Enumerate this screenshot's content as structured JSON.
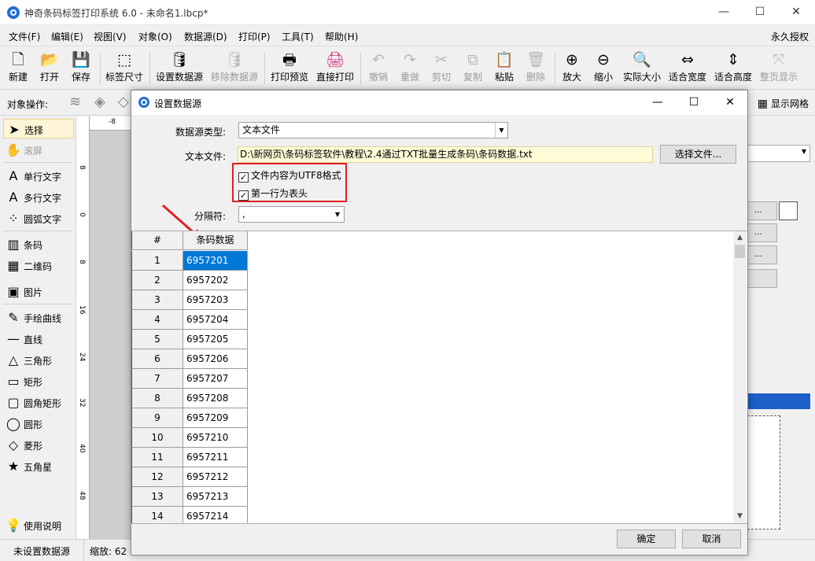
{
  "window": {
    "title": "神奇条码标签打印系统 6.0 - 未命名1.lbcp*",
    "minimize": "—",
    "maximize": "☐",
    "close": "✕"
  },
  "menu": {
    "items": [
      "文件(F)",
      "编辑(E)",
      "视图(V)",
      "对象(O)",
      "数据源(D)",
      "打印(P)",
      "工具(T)",
      "帮助(H)"
    ],
    "license": "永久授权"
  },
  "toolbar": {
    "buttons": [
      {
        "label": "新建",
        "icon": "new-file-icon",
        "glyph": "🗋",
        "enabled": true
      },
      {
        "label": "打开",
        "icon": "open-icon",
        "glyph": "📂",
        "enabled": true
      },
      {
        "label": "保存",
        "icon": "save-icon",
        "glyph": "💾",
        "enabled": true
      },
      {
        "label": "标签尺寸",
        "icon": "label-size-icon",
        "glyph": "⬚",
        "enabled": true
      },
      {
        "label": "设置数据源",
        "icon": "database-icon",
        "glyph": "🛢",
        "enabled": true
      },
      {
        "label": "移除数据源",
        "icon": "database-remove-icon",
        "glyph": "🛢",
        "enabled": false
      },
      {
        "label": "打印预览",
        "icon": "print-preview-icon",
        "glyph": "🖶",
        "enabled": true
      },
      {
        "label": "直接打印",
        "icon": "print-icon",
        "glyph": "🖨",
        "enabled": true
      },
      {
        "label": "撤销",
        "icon": "undo-icon",
        "glyph": "↶",
        "enabled": false
      },
      {
        "label": "重做",
        "icon": "redo-icon",
        "glyph": "↷",
        "enabled": false
      },
      {
        "label": "剪切",
        "icon": "cut-icon",
        "glyph": "✂",
        "enabled": false
      },
      {
        "label": "复制",
        "icon": "copy-icon",
        "glyph": "⧉",
        "enabled": false
      },
      {
        "label": "粘贴",
        "icon": "paste-icon",
        "glyph": "📋",
        "enabled": true
      },
      {
        "label": "删除",
        "icon": "delete-icon",
        "glyph": "🗑",
        "enabled": false
      },
      {
        "label": "放大",
        "icon": "zoom-in-icon",
        "glyph": "⊕",
        "enabled": true
      },
      {
        "label": "缩小",
        "icon": "zoom-out-icon",
        "glyph": "⊖",
        "enabled": true
      },
      {
        "label": "实际大小",
        "icon": "actual-size-icon",
        "glyph": "🔍",
        "enabled": true
      },
      {
        "label": "适合宽度",
        "icon": "fit-width-icon",
        "glyph": "⇔",
        "enabled": true
      },
      {
        "label": "适合高度",
        "icon": "fit-height-icon",
        "glyph": "⇕",
        "enabled": true
      },
      {
        "label": "整页显示",
        "icon": "fit-page-icon",
        "glyph": "⤧",
        "enabled": false
      }
    ]
  },
  "object_bar": {
    "label": "对象操作:",
    "grid_toggle": "显示网格"
  },
  "tools": {
    "items": [
      {
        "label": "选择",
        "glyph": "➤",
        "selected": true,
        "enabled": true
      },
      {
        "label": "滚屏",
        "glyph": "✋",
        "selected": false,
        "enabled": false
      },
      {
        "label": "单行文字",
        "glyph": "A",
        "selected": false,
        "enabled": true
      },
      {
        "label": "多行文字",
        "glyph": "A",
        "selected": false,
        "enabled": true
      },
      {
        "label": "圆弧文字",
        "glyph": "⁘",
        "selected": false,
        "enabled": true
      },
      {
        "label": "条码",
        "glyph": "▥",
        "selected": false,
        "enabled": true
      },
      {
        "label": "二维码",
        "glyph": "▦",
        "selected": false,
        "enabled": true
      },
      {
        "label": "图片",
        "glyph": "▣",
        "selected": false,
        "enabled": true
      },
      {
        "label": "手绘曲线",
        "glyph": "✎",
        "selected": false,
        "enabled": true
      },
      {
        "label": "直线",
        "glyph": "—",
        "selected": false,
        "enabled": true
      },
      {
        "label": "三角形",
        "glyph": "△",
        "selected": false,
        "enabled": true
      },
      {
        "label": "矩形",
        "glyph": "▭",
        "selected": false,
        "enabled": true
      },
      {
        "label": "圆角矩形",
        "glyph": "▢",
        "selected": false,
        "enabled": true
      },
      {
        "label": "圆形",
        "glyph": "◯",
        "selected": false,
        "enabled": true
      },
      {
        "label": "菱形",
        "glyph": "◇",
        "selected": false,
        "enabled": true
      },
      {
        "label": "五角星",
        "glyph": "★",
        "selected": false,
        "enabled": true
      }
    ],
    "help": {
      "label": "使用说明",
      "glyph": "💡"
    }
  },
  "ruler": {
    "top_mark": "-8",
    "left_marks": [
      "8",
      "0",
      "8",
      "16",
      "24",
      "32",
      "40",
      "48"
    ]
  },
  "status": {
    "datasource": "未设置数据源",
    "zoom": "缩放: 62"
  },
  "dialog": {
    "title": "设置数据源",
    "source_type_label": "数据源类型:",
    "source_type_value": "文本文件",
    "text_file_label": "文本文件:",
    "text_file_path": "D:\\新网页\\条码标签软件\\教程\\2.4通过TXT批量生成条码\\条码数据.txt",
    "choose_file_button": "选择文件...",
    "utf8_checkbox": {
      "label": "文件内容为UTF8格式",
      "checked": true
    },
    "header_checkbox": {
      "label": "第一行为表头",
      "checked": true
    },
    "separator_label": "分隔符:",
    "separator_value": ",",
    "grid": {
      "row_header": "#",
      "column_header": "条码数据",
      "rows": [
        {
          "n": "1",
          "v": "6957201"
        },
        {
          "n": "2",
          "v": "6957202"
        },
        {
          "n": "3",
          "v": "6957203"
        },
        {
          "n": "4",
          "v": "6957204"
        },
        {
          "n": "5",
          "v": "6957205"
        },
        {
          "n": "6",
          "v": "6957206"
        },
        {
          "n": "7",
          "v": "6957207"
        },
        {
          "n": "8",
          "v": "6957208"
        },
        {
          "n": "9",
          "v": "6957209"
        },
        {
          "n": "10",
          "v": "6957210"
        },
        {
          "n": "11",
          "v": "6957211"
        },
        {
          "n": "12",
          "v": "6957212"
        },
        {
          "n": "13",
          "v": "6957213"
        },
        {
          "n": "14",
          "v": "6957214"
        }
      ]
    },
    "ok_button": "确定",
    "cancel_button": "取消"
  },
  "colors": {
    "selection": "#0078d7",
    "highlight": "#e02020",
    "path_background": "#fffbd6",
    "app_icon": "#1e6fd6"
  }
}
